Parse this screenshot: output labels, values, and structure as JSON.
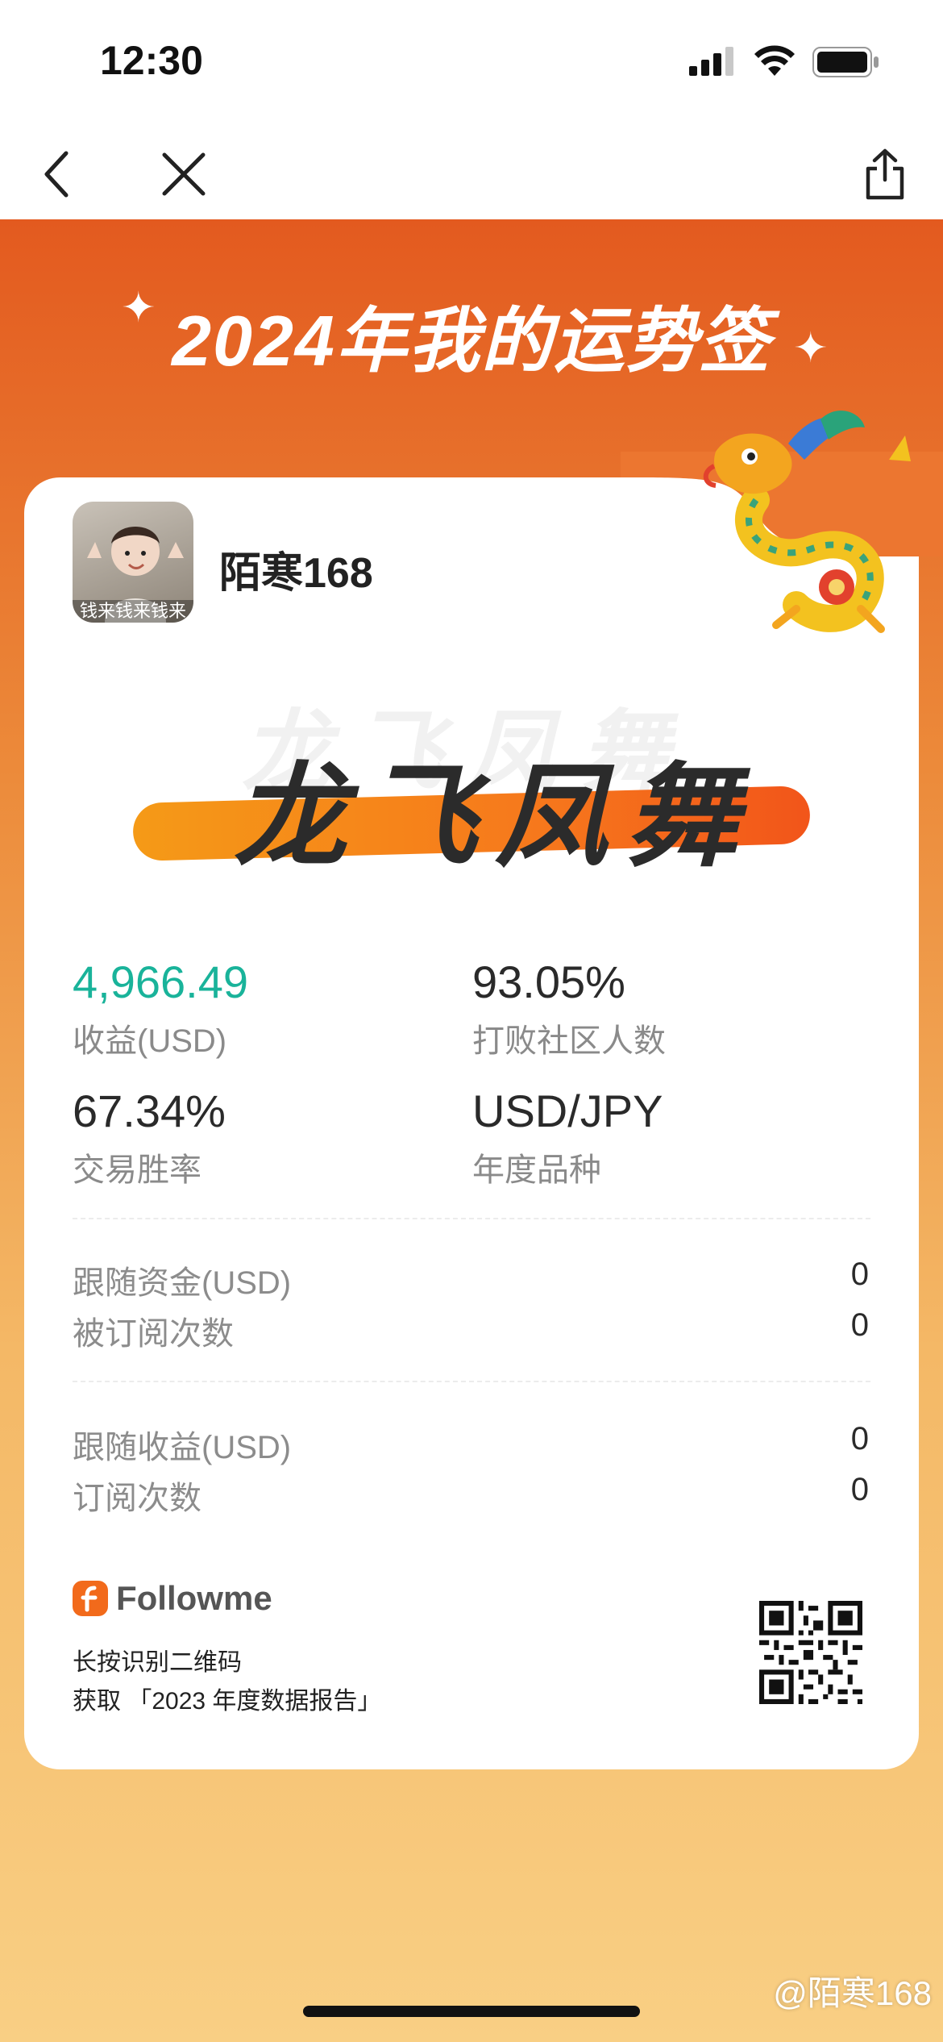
{
  "status_bar": {
    "time": "12:30"
  },
  "title": "2024年我的运势签",
  "user": {
    "name": "陌寒168",
    "avatar_caption": "钱来钱来钱来"
  },
  "fortune": "龙飞凤舞",
  "stats": [
    {
      "value": "4,966.49",
      "label": "收益(USD)"
    },
    {
      "value": "93.05%",
      "label": "打败社区人数"
    },
    {
      "value": "67.34%",
      "label": "交易胜率"
    },
    {
      "value": "USD/JPY",
      "label": "年度品种"
    }
  ],
  "rows": [
    {
      "label": "跟随资金(USD)",
      "value": "0"
    },
    {
      "label": "被订阅次数",
      "value": "0"
    },
    {
      "label": "跟随收益(USD)",
      "value": "0"
    },
    {
      "label": "订阅次数",
      "value": "0"
    }
  ],
  "footer": {
    "brand": "Followme",
    "line1": "长按识别二维码",
    "line2": "获取 「2023 年度数据报告」"
  },
  "watermark": "@陌寒168",
  "colors": {
    "accent_orange": "#e35a1f",
    "profit_green": "#19b39a"
  },
  "icons": [
    "back-icon",
    "close-icon",
    "share-icon",
    "signal-icon",
    "wifi-icon",
    "battery-icon",
    "followme-logo-icon",
    "qr-code"
  ]
}
